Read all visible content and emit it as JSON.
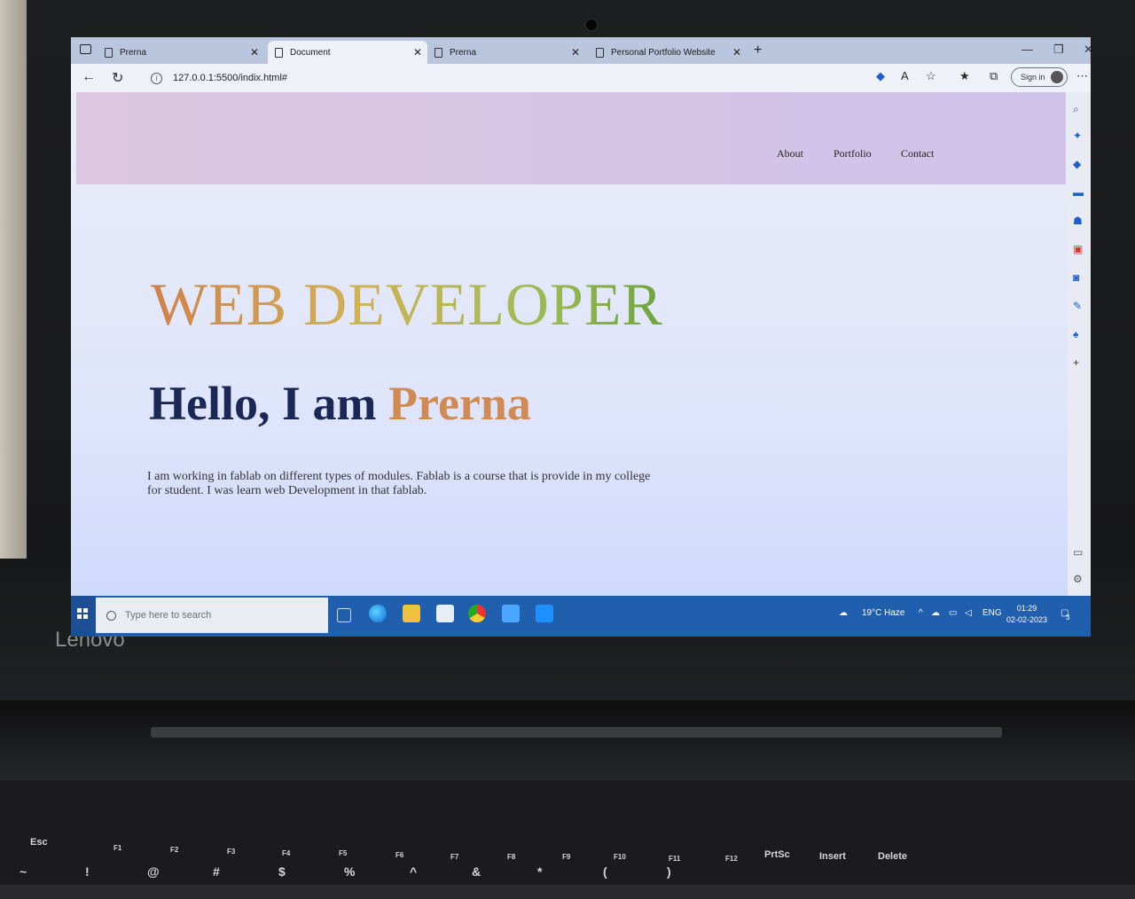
{
  "laptop": {
    "brand": "Lenovo"
  },
  "browser": {
    "tabs": [
      {
        "title": "Prerna"
      },
      {
        "title": "Document"
      },
      {
        "title": "Prerna"
      },
      {
        "title": "Personal Portfolio Website"
      }
    ],
    "url": "127.0.0.1:5500/indix.html#",
    "sign_in_label": "Sign in"
  },
  "page": {
    "nav": [
      "About",
      "Portfolio",
      "Contact"
    ],
    "hero_title": "WEB DEVELOPER",
    "greeting_prefix": "Hello, I am",
    "greeting_name": "Prerna",
    "intro": "I am working in fablab on different types of modules. Fablab is a course that is provide in my college for student. I was learn web Development in that fablab."
  },
  "taskbar": {
    "search_placeholder": "Type here to search",
    "weather": "19°C Haze",
    "language": "ENG",
    "time": "01:29",
    "date": "02-02-2023",
    "notification_count": "3"
  },
  "keyboard": {
    "row1": [
      "Esc",
      "F1",
      "F2",
      "F3",
      "F4",
      "F5",
      "F6",
      "F7",
      "F8",
      "F9",
      "F10",
      "F11",
      "F12",
      "PrtSc",
      "Insert",
      "Delete"
    ],
    "row2": [
      "~",
      "!",
      "@",
      "#",
      "$",
      "%",
      "^",
      "&",
      "*",
      "(",
      ")"
    ]
  },
  "colors": {
    "hero_gradient_start": "#d1814a",
    "hero_gradient_end": "#6fa33e",
    "greeting_dark": "#1b2754",
    "greeting_accent": "#d08a54",
    "taskbar": "#1f5fae"
  }
}
